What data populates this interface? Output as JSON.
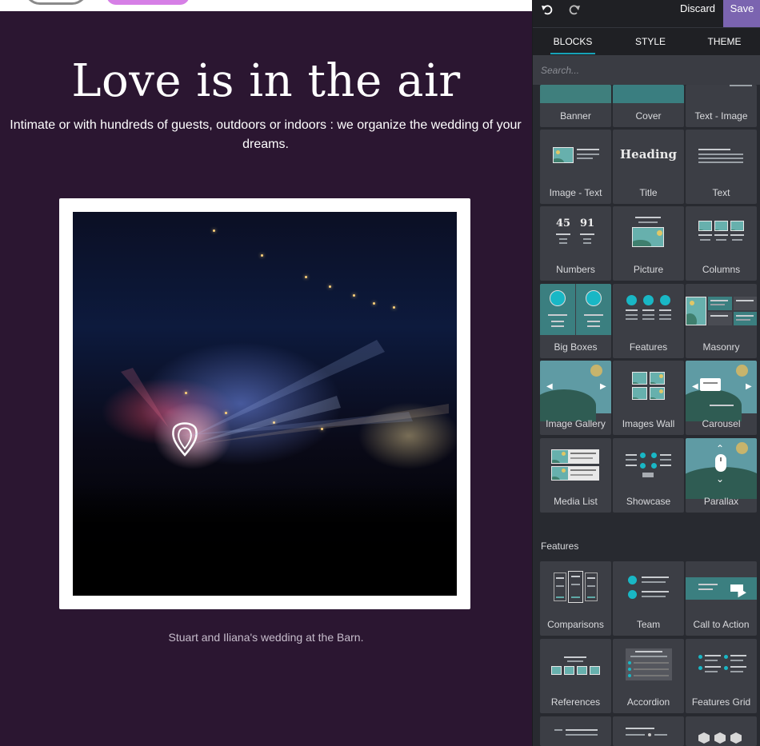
{
  "preview": {
    "hero_title": "Love is in the air",
    "hero_subtitle": "Intimate or with hundreds of guests, outdoors or indoors : we organize the wedding of your dreams.",
    "caption": "Stuart and Iliana's wedding at the Barn."
  },
  "toolbar": {
    "undo_icon": "undo-icon",
    "redo_icon": "redo-icon",
    "discard_label": "Discard",
    "save_label": "Save",
    "accent": "#7b64b0"
  },
  "tabs": {
    "blocks": "BLOCKS",
    "style": "STYLE",
    "theme": "THEME",
    "active": "BLOCKS",
    "underline_color": "#17a2b8"
  },
  "search": {
    "placeholder": "Search..."
  },
  "blocks": {
    "row0": [
      "Banner",
      "Cover",
      "Text - Image"
    ],
    "row1": [
      "Image - Text",
      "Title",
      "Text"
    ],
    "row2": [
      "Numbers",
      "Picture",
      "Columns"
    ],
    "row3": [
      "Big Boxes",
      "Features",
      "Masonry"
    ],
    "row4": [
      "Image Gallery",
      "Images Wall",
      "Carousel"
    ],
    "row5": [
      "Media List",
      "Showcase",
      "Parallax"
    ],
    "title_thumb_text": "Heading",
    "numbers_thumb": [
      "45",
      "91"
    ]
  },
  "features_section": {
    "title": "Features",
    "row0": [
      "Comparisons",
      "Team",
      "Call to Action"
    ],
    "row1": [
      "References",
      "Accordion",
      "Features Grid"
    ]
  }
}
